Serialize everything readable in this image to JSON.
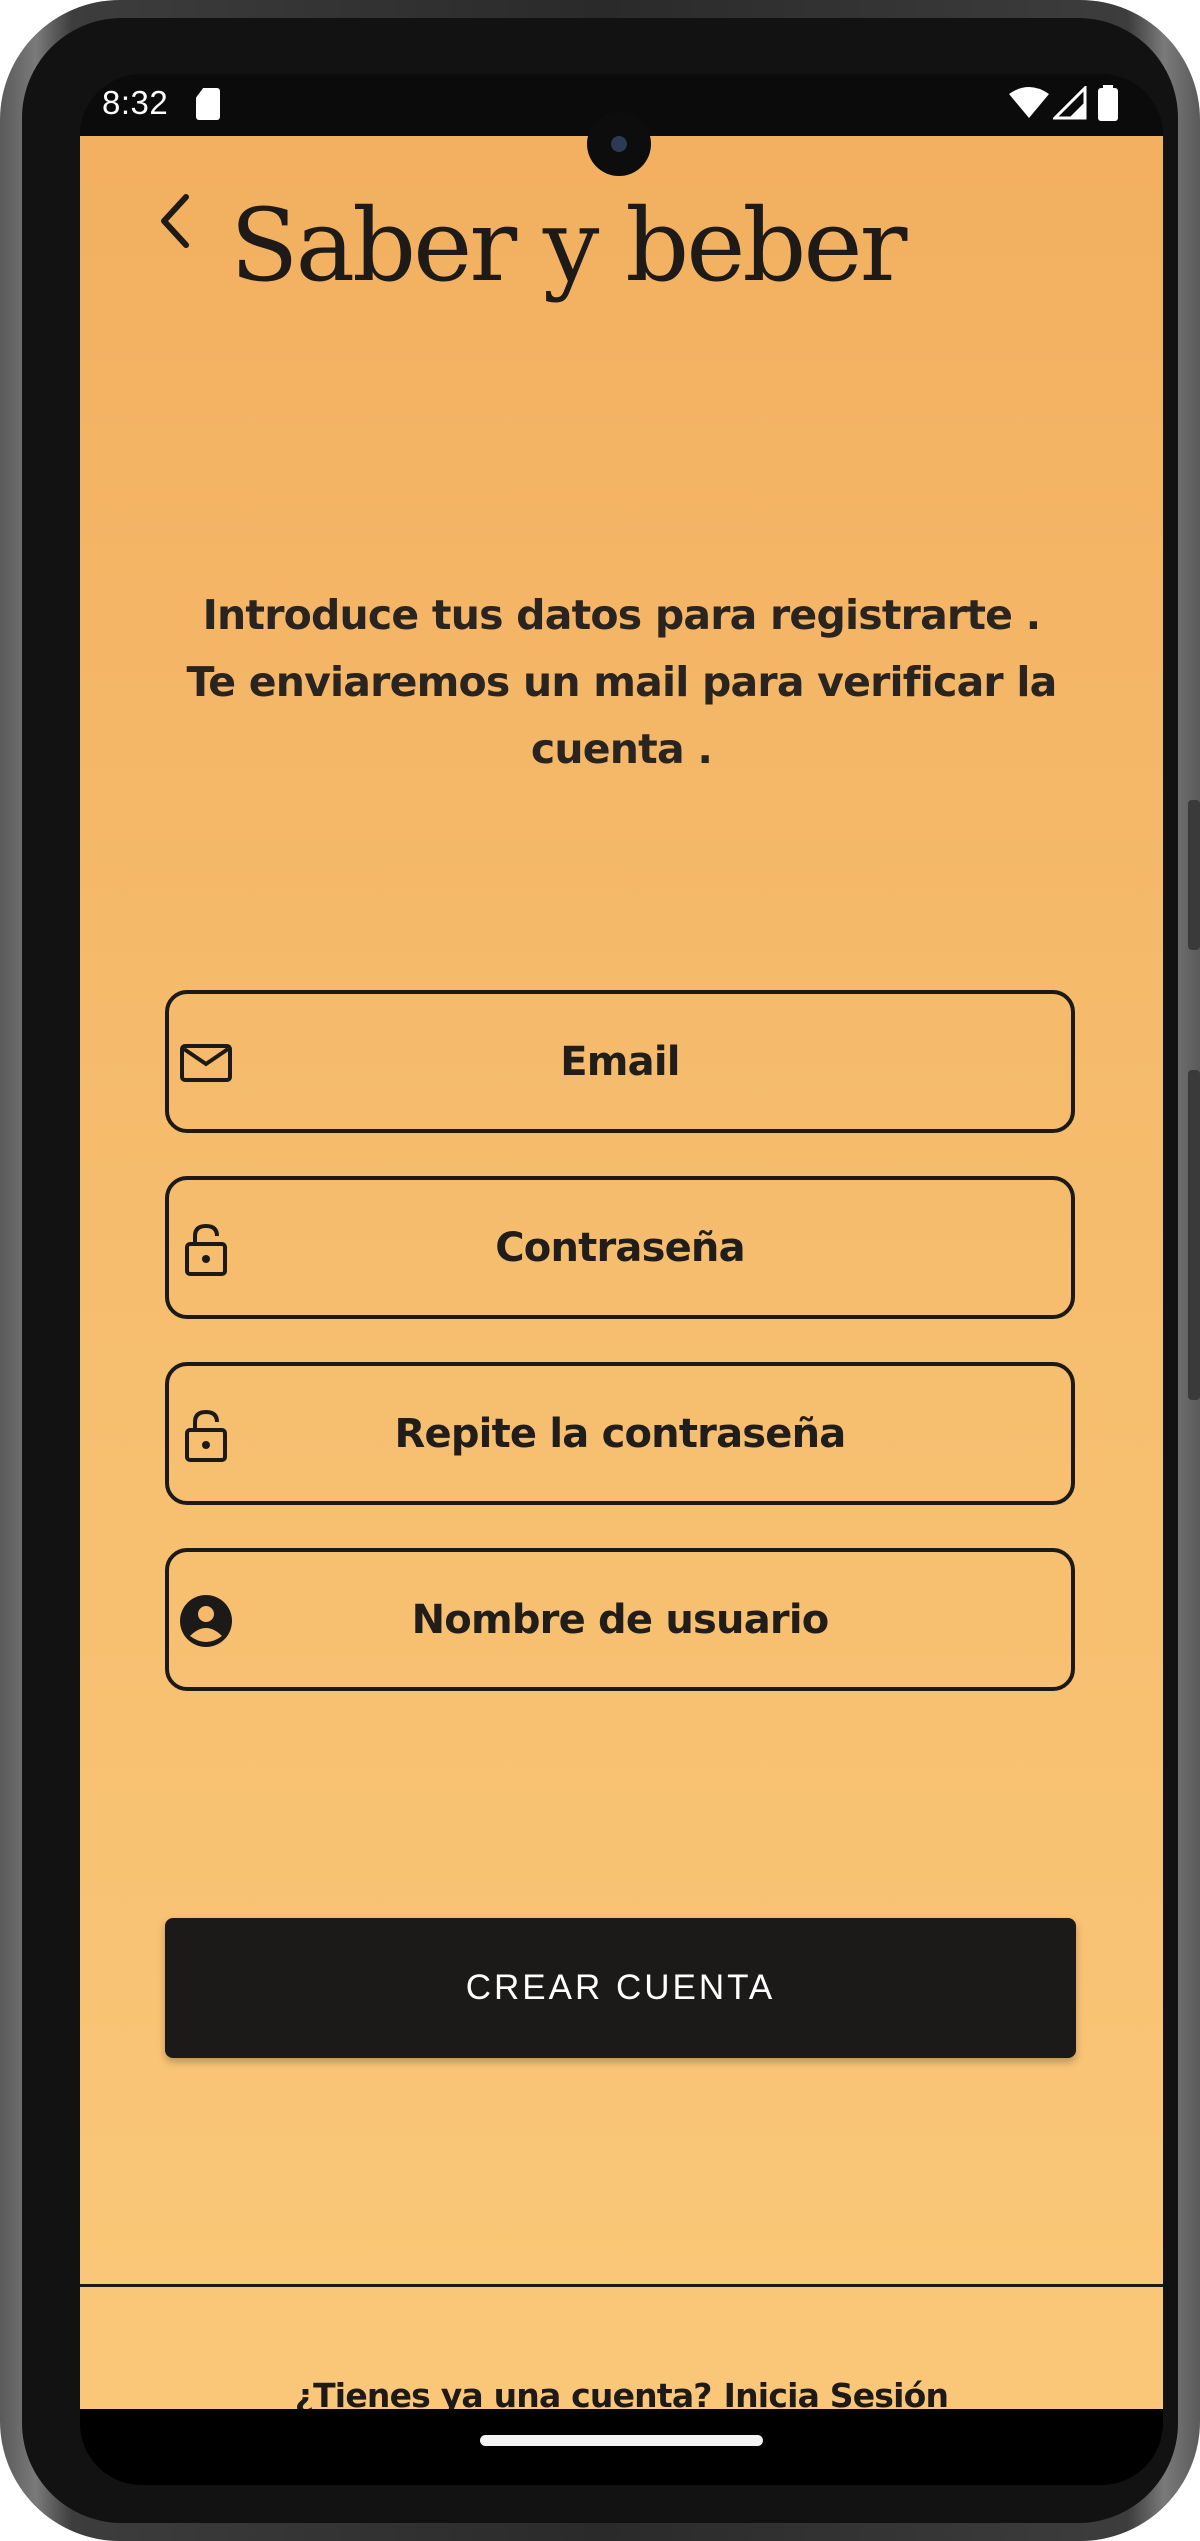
{
  "status_bar": {
    "time": "8:32",
    "icons": [
      "sd-card-icon",
      "wifi-icon",
      "signal-icon",
      "battery-icon"
    ]
  },
  "header": {
    "back_icon": "chevron-left-icon",
    "title": "Saber y beber"
  },
  "intro": {
    "lines": [
      "Introduce tus datos para registrarte .",
      "Te enviaremos un mail para verificar la",
      "cuenta ."
    ]
  },
  "form": {
    "fields": [
      {
        "icon": "mail-icon",
        "placeholder": "Email",
        "value": ""
      },
      {
        "icon": "lock-icon",
        "placeholder": "Contraseña",
        "value": ""
      },
      {
        "icon": "lock-icon",
        "placeholder": "Repite la contraseña",
        "value": ""
      },
      {
        "icon": "account-circle-icon",
        "placeholder": "Nombre de usuario",
        "value": ""
      }
    ],
    "submit_label": "CREAR CUENTA"
  },
  "footer": {
    "prompt": "¿Tienes ya una cuenta?",
    "link_label": "Inicia Sesión"
  },
  "colors": {
    "background_top": "#f2b060",
    "background_bottom": "#fac778",
    "text": "#1e1a17",
    "button": "#1c1a19",
    "button_text": "#ffffff"
  }
}
